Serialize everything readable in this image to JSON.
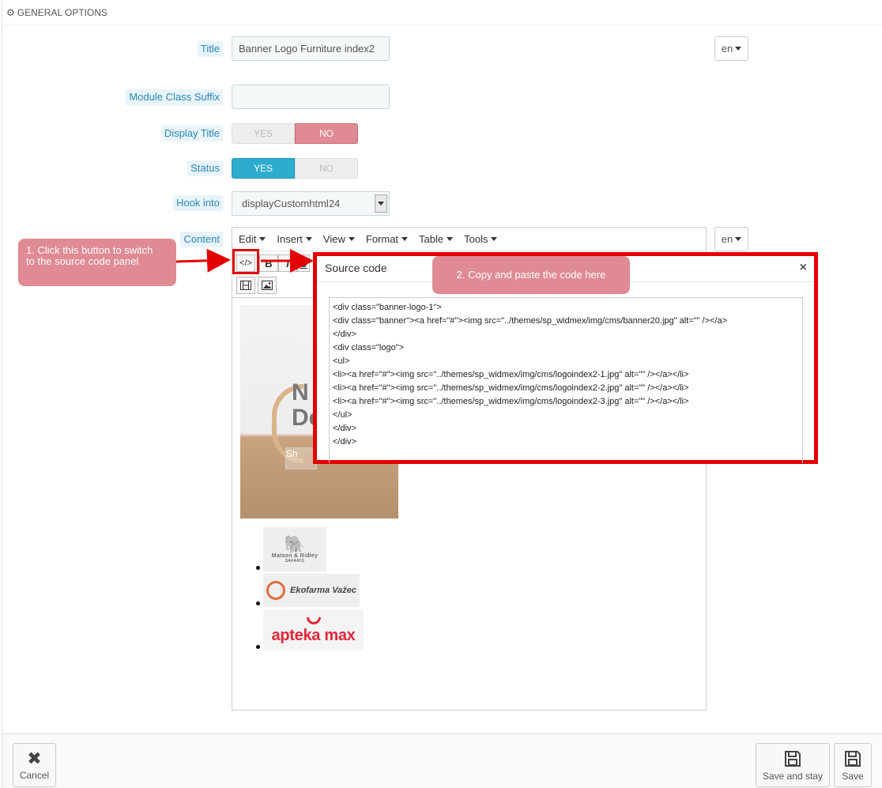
{
  "panel": {
    "heading": "GENERAL OPTIONS"
  },
  "form": {
    "title_label": "Title",
    "title_value": "Banner Logo Furniture index2",
    "title_lang": "en",
    "suffix_label": "Module Class Suffix",
    "suffix_value": "",
    "display_title_label": "Display Title",
    "display_title_yes": "YES",
    "display_title_no": "NO",
    "display_title_value": "NO",
    "status_label": "Status",
    "status_yes": "YES",
    "status_no": "NO",
    "status_value": "YES",
    "hook_label": "Hook into",
    "hook_value": "displayCustomhtml24",
    "content_label": "Content",
    "content_lang": "en"
  },
  "editor": {
    "menu": [
      "Edit",
      "Insert",
      "View",
      "Format",
      "Table",
      "Tools"
    ],
    "toolbar": {
      "source": "</>",
      "bold": "B",
      "italic": "I",
      "underline": "U"
    },
    "banner_text": "N\nDes",
    "banner_button": "Sh",
    "logos": [
      {
        "name": "Matson & Ridley",
        "sub": "SAFARIS"
      },
      {
        "name": "Ekofarma Važec"
      },
      {
        "name": "apteka max"
      }
    ]
  },
  "modal": {
    "title": "Source code",
    "close": "×",
    "code": "<div class=\"banner-logo-1\">\n<div class=\"banner\"><a href=\"#\"><img src=\"../themes/sp_widmex/img/cms/banner20.jpg\" alt=\"\" /></a>\n</div>\n<div class=\"logo\">\n<ul>\n<li><a href=\"#\"><img src=\"../themes/sp_widmex/img/cms/logoindex2-1.jpg\" alt=\"\" /></a></li>\n<li><a href=\"#\"><img src=\"../themes/sp_widmex/img/cms/logoindex2-2.jpg\" alt=\"\" /></a></li>\n<li><a href=\"#\"><img src=\"../themes/sp_widmex/img/cms/logoindex2-3.jpg\" alt=\"\" /></a></li>\n</ul>\n</div>\n</div>"
  },
  "callouts": {
    "step1": "1. Click this button to switch\nto the source code panel",
    "step2": "2. Copy and paste the code here"
  },
  "footer": {
    "cancel": "Cancel",
    "save_stay": "Save and stay",
    "save": "Save"
  },
  "colors": {
    "accent_blue": "#2eacce",
    "toggle_no": "#e08a93",
    "highlight_red": "#e30000",
    "label_blue": "#2a87b8"
  }
}
